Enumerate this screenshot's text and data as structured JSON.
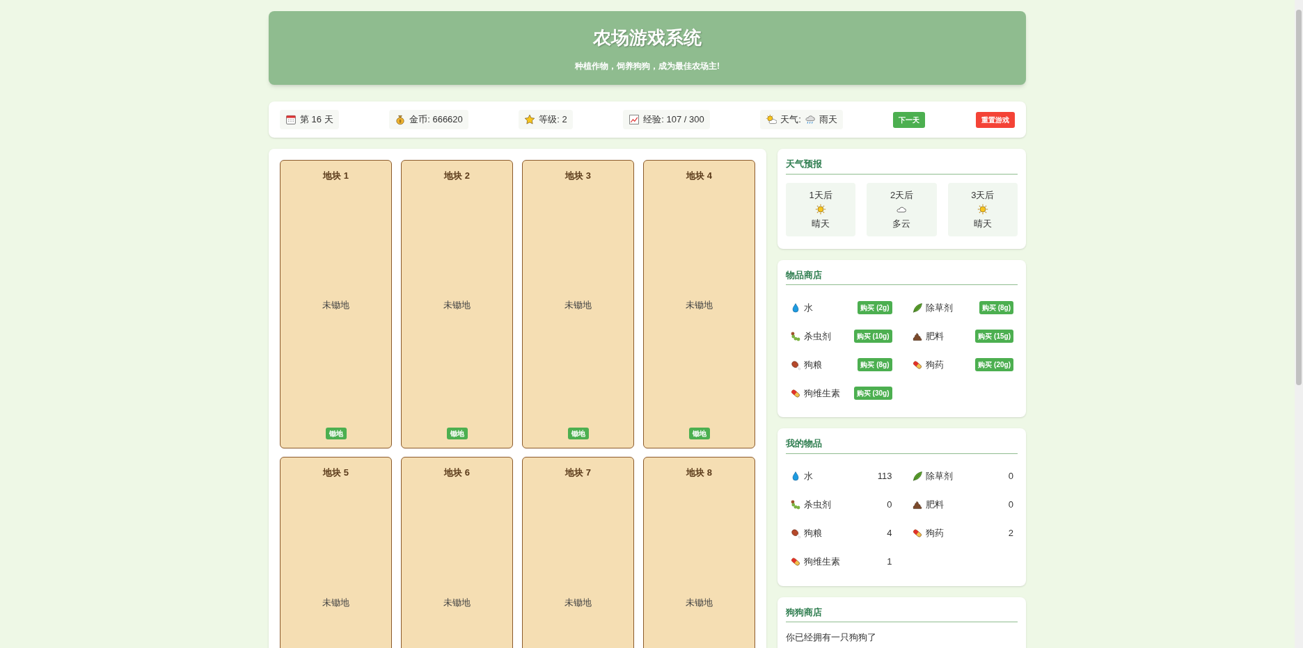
{
  "header": {
    "title": "农场游戏系统",
    "subtitle": "种植作物，饲养狗狗，成为最佳农场主!"
  },
  "stats": [
    {
      "label": "第 16 天"
    },
    {
      "label": "金币: 666620"
    },
    {
      "label": "等级: 2"
    },
    {
      "label": "经验: 107 / 300"
    },
    {
      "label": "天气:",
      "value": "雨天"
    }
  ],
  "actions": [
    {
      "label": "下一天",
      "kind": "primary"
    },
    {
      "label": "重置游戏",
      "kind": "danger"
    }
  ],
  "plots": [
    {
      "title": "地块 1",
      "status": "未锄地",
      "button": "锄地"
    },
    {
      "title": "地块 2",
      "status": "未锄地",
      "button": "锄地"
    },
    {
      "title": "地块 3",
      "status": "未锄地",
      "button": "锄地"
    },
    {
      "title": "地块 4",
      "status": "未锄地",
      "button": "锄地"
    },
    {
      "title": "地块 5",
      "status": "未锄地"
    },
    {
      "title": "地块 6",
      "status": "未锄地"
    },
    {
      "title": "地块 7",
      "status": "未锄地"
    },
    {
      "title": "地块 8",
      "status": "未锄地"
    }
  ],
  "forecast": {
    "title": "天气预报",
    "days": [
      {
        "day": "1天后",
        "weather": "晴天"
      },
      {
        "day": "2天后",
        "weather": "多云"
      },
      {
        "day": "3天后",
        "weather": "晴天"
      }
    ]
  },
  "shop": {
    "title": "物品商店",
    "items": [
      {
        "name": "水",
        "button": "购买 (2g)"
      },
      {
        "name": "除草剂",
        "button": "购买 (8g)"
      },
      {
        "name": "杀虫剂",
        "button": "购买 (10g)"
      },
      {
        "name": "肥料",
        "button": "购买 (15g)"
      },
      {
        "name": "狗粮",
        "button": "购买 (8g)"
      },
      {
        "name": "狗药",
        "button": "购买 (20g)"
      },
      {
        "name": "狗维生素",
        "button": "购买 (30g)"
      }
    ]
  },
  "inventory": {
    "title": "我的物品",
    "items": [
      {
        "name": "水",
        "count": "113"
      },
      {
        "name": "除草剂",
        "count": "0"
      },
      {
        "name": "杀虫剂",
        "count": "0"
      },
      {
        "name": "肥料",
        "count": "0"
      },
      {
        "name": "狗粮",
        "count": "4"
      },
      {
        "name": "狗药",
        "count": "2"
      },
      {
        "name": "狗维生素",
        "count": "1"
      }
    ]
  },
  "dog_shop": {
    "title": "狗狗商店",
    "message": "你已经拥有一只狗狗了"
  }
}
